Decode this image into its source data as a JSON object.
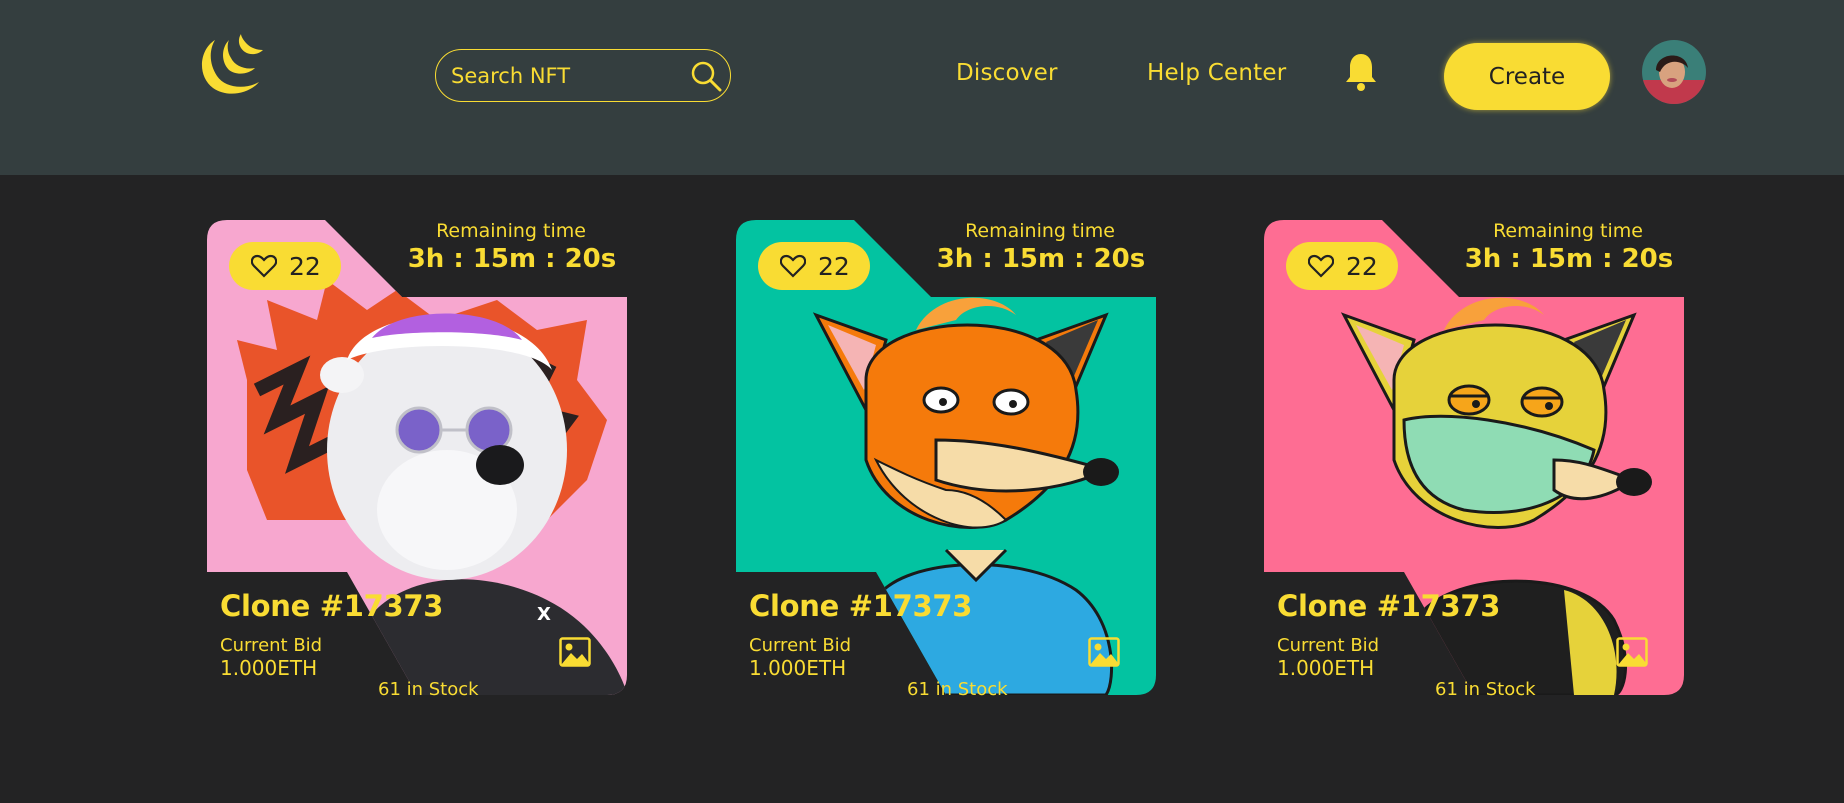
{
  "header": {
    "search": {
      "placeholder": "Search NFT"
    },
    "nav": {
      "discover": "Discover",
      "help_center": "Help Center"
    },
    "create_label": "Create",
    "icons": [
      "logo-icon",
      "search-icon",
      "bell-icon",
      "avatar"
    ]
  },
  "cards": [
    {
      "likes": "22",
      "remaining_label": "Remaining time",
      "remaining_time": "3h : 15m : 20s",
      "title": "Clone #17373",
      "bid_label": "Current Bid",
      "bid_value": "1.000ETH",
      "stock": "61 in Stock",
      "bg_color": "#f7a7cf",
      "art": "polar-bear"
    },
    {
      "likes": "22",
      "remaining_label": "Remaining time",
      "remaining_time": "3h : 15m : 20s",
      "title": "Clone #17373",
      "bid_label": "Current Bid",
      "bid_value": "1.000ETH",
      "stock": "61 in Stock",
      "bg_color": "#03c3a1",
      "art": "orange-fox"
    },
    {
      "likes": "22",
      "remaining_label": "Remaining time",
      "remaining_time": "3h : 15m : 20s",
      "title": "Clone #17373",
      "bid_label": "Current Bid",
      "bid_value": "1.000ETH",
      "stock": "61 in Stock",
      "bg_color": "#fe6d93",
      "art": "masked-fox"
    }
  ],
  "colors": {
    "accent": "#f9dc33",
    "header_bg": "#343e3f",
    "page_bg": "#232324"
  }
}
